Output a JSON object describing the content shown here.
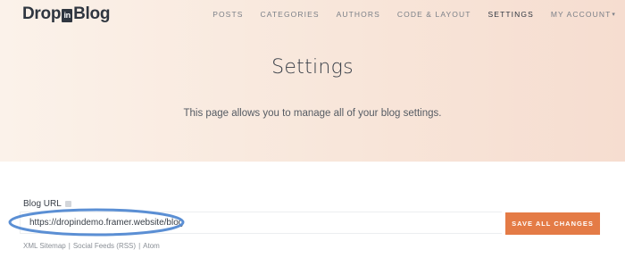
{
  "brand": {
    "part1": "Drop",
    "badge": "in",
    "part2": "Blog"
  },
  "nav": {
    "items": [
      {
        "label": "POSTS"
      },
      {
        "label": "CATEGORIES"
      },
      {
        "label": "AUTHORS"
      },
      {
        "label": "CODE & LAYOUT"
      },
      {
        "label": "SETTINGS",
        "active": true
      },
      {
        "label": "MY ACCOUNT",
        "has_dropdown": true
      }
    ],
    "dropdown_caret": "▾"
  },
  "hero": {
    "title": "Settings",
    "subtitle": "This page allows you to manage all of your blog settings."
  },
  "blog_url": {
    "label": "Blog URL",
    "value": "https://dropindemo.framer.website/blog",
    "save_label": "SAVE ALL CHANGES"
  },
  "links": {
    "items": [
      "XML Sitemap",
      "Social Feeds (RSS)",
      "Atom"
    ],
    "separator": "|"
  },
  "colors": {
    "accent": "#e47b46",
    "annotation": "#5b8fd4",
    "text_dark": "#2f3640",
    "nav_text": "#7a7f87"
  }
}
